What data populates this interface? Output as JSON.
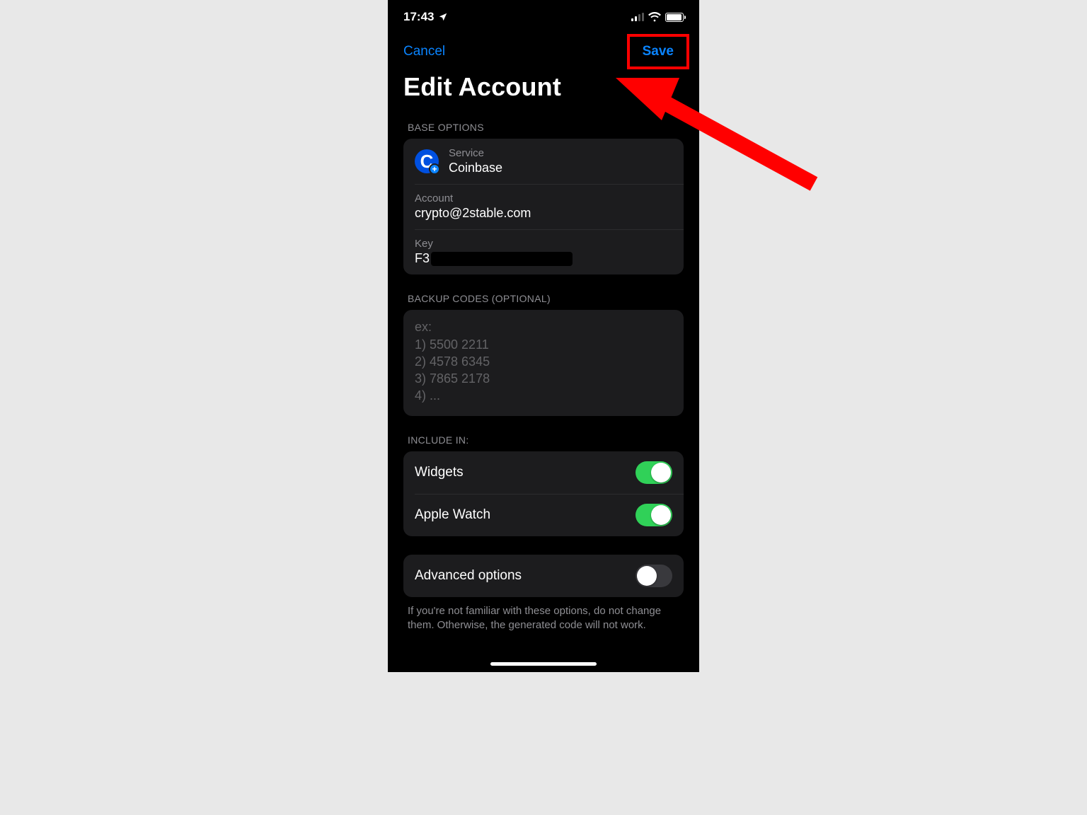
{
  "status_bar": {
    "time": "17:43"
  },
  "nav": {
    "cancel_label": "Cancel",
    "save_label": "Save"
  },
  "page_title": "Edit Account",
  "sections": {
    "base_options": {
      "header": "BASE OPTIONS",
      "service": {
        "label": "Service",
        "value": "Coinbase"
      },
      "account": {
        "label": "Account",
        "value": "crypto@2stable.com"
      },
      "key": {
        "label": "Key",
        "value_visible_prefix": "F3"
      }
    },
    "backup_codes": {
      "header": "BACKUP CODES (OPTIONAL)",
      "placeholder": "ex:\n1) 5500 2211\n2) 4578 6345\n3) 7865 2178\n4) ..."
    },
    "include_in": {
      "header": "INCLUDE IN:",
      "items": [
        {
          "label": "Widgets",
          "on": true
        },
        {
          "label": "Apple Watch",
          "on": true
        }
      ]
    },
    "advanced": {
      "label": "Advanced options",
      "on": false,
      "note": "If you're not familiar with these options, do not change them. Otherwise, the generated code will not work."
    }
  },
  "annotation": {
    "highlight_target": "save-button",
    "arrow_color": "#ff0000"
  }
}
